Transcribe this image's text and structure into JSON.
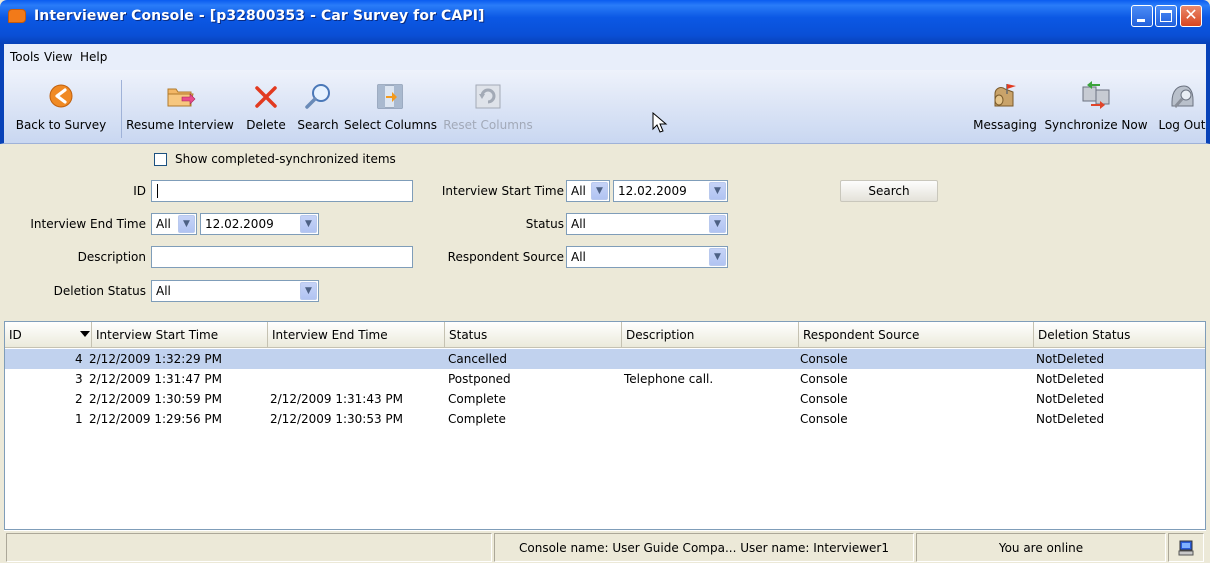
{
  "window": {
    "title": "Interviewer Console - [p32800353 - Car Survey for CAPI]"
  },
  "menu": {
    "tools": "Tools",
    "view": "View",
    "help": "Help"
  },
  "toolbar": {
    "back": "Back to Survey",
    "resume": "Resume Interview",
    "delete": "Delete",
    "search": "Search",
    "select_columns": "Select Columns",
    "reset_columns": "Reset Columns",
    "messaging": "Messaging",
    "synchronize": "Synchronize Now",
    "logout": "Log Out"
  },
  "filters": {
    "show_completed_label": "Show completed-synchronized items",
    "show_completed_checked": false,
    "id_label": "ID",
    "id_value": "",
    "start_time_label": "Interview Start Time",
    "start_time_mode": "All",
    "start_time_date": "12.02.2009",
    "search_button": "Search",
    "end_time_label": "Interview End Time",
    "end_time_mode": "All",
    "end_time_date": "12.02.2009",
    "status_label": "Status",
    "status_value": "All",
    "description_label": "Description",
    "description_value": "",
    "respondent_source_label": "Respondent Source",
    "respondent_source_value": "All",
    "deletion_status_label": "Deletion Status",
    "deletion_status_value": "All"
  },
  "table": {
    "columns": [
      "ID",
      "Interview Start Time",
      "Interview End Time",
      "Status",
      "Description",
      "Respondent Source",
      "Deletion Status"
    ],
    "rows": [
      {
        "id": "4",
        "start": "2/12/2009 1:32:29 PM",
        "end": "",
        "status": "Cancelled",
        "description": "",
        "source": "Console",
        "deletion": "NotDeleted",
        "selected": true
      },
      {
        "id": "3",
        "start": "2/12/2009 1:31:47 PM",
        "end": "",
        "status": "Postponed",
        "description": "Telephone call.",
        "source": "Console",
        "deletion": "NotDeleted",
        "selected": false
      },
      {
        "id": "2",
        "start": "2/12/2009 1:30:59 PM",
        "end": "2/12/2009 1:31:43 PM",
        "status": "Complete",
        "description": "",
        "source": "Console",
        "deletion": "NotDeleted",
        "selected": false
      },
      {
        "id": "1",
        "start": "2/12/2009 1:29:56 PM",
        "end": "2/12/2009 1:30:53 PM",
        "status": "Complete",
        "description": "",
        "source": "Console",
        "deletion": "NotDeleted",
        "selected": false
      }
    ]
  },
  "statusbar": {
    "console_info": "Console name: User Guide Compa...  User name: Interviewer1",
    "online": "You are online"
  },
  "icons": {
    "back": "back-arrow-icon",
    "resume": "folder-arrow-icon",
    "delete": "delete-x-icon",
    "search": "magnifier-icon",
    "select_columns": "columns-icon",
    "reset_columns": "reset-columns-icon",
    "messaging": "mailbox-icon",
    "synchronize": "sync-computers-icon",
    "logout": "logout-icon",
    "online": "computer-icon"
  }
}
